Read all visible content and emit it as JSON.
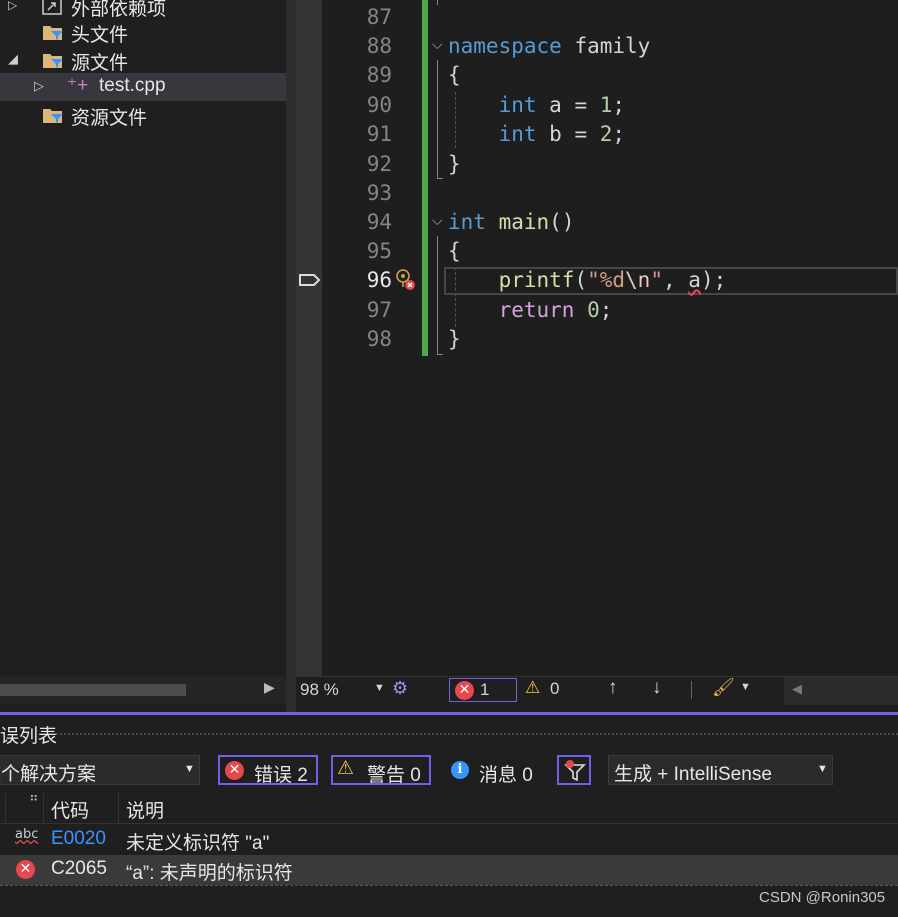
{
  "explorer": {
    "items": [
      {
        "label": "外部依赖项"
      },
      {
        "label": "头文件"
      },
      {
        "label": "源文件"
      },
      {
        "label": "test.cpp"
      },
      {
        "label": "资源文件"
      }
    ]
  },
  "editor": {
    "line_numbers": [
      "87",
      "88",
      "89",
      "90",
      "91",
      "92",
      "93",
      "94",
      "95",
      "96",
      "97",
      "98"
    ],
    "zoom": "98 %",
    "error_count": "1",
    "warning_count": "0"
  },
  "error_list": {
    "title": "错误列表",
    "scope": "整个解决方案",
    "errors_btn": "错误 2",
    "warnings_btn": "警告 0",
    "messages_btn": "消息 0",
    "source": "生成 + IntelliSense",
    "col_code": "代码",
    "col_desc": "说明",
    "rows": [
      {
        "code": "E0020",
        "desc": "未定义标识符 \"a\""
      },
      {
        "code": "C2065",
        "desc": "“a”: 未声明的标识符"
      }
    ]
  },
  "watermark": "CSDN @Ronin305",
  "colors": {
    "accent": "#7160e8",
    "error": "#e5484d",
    "change_bar": "#4ea94e"
  }
}
